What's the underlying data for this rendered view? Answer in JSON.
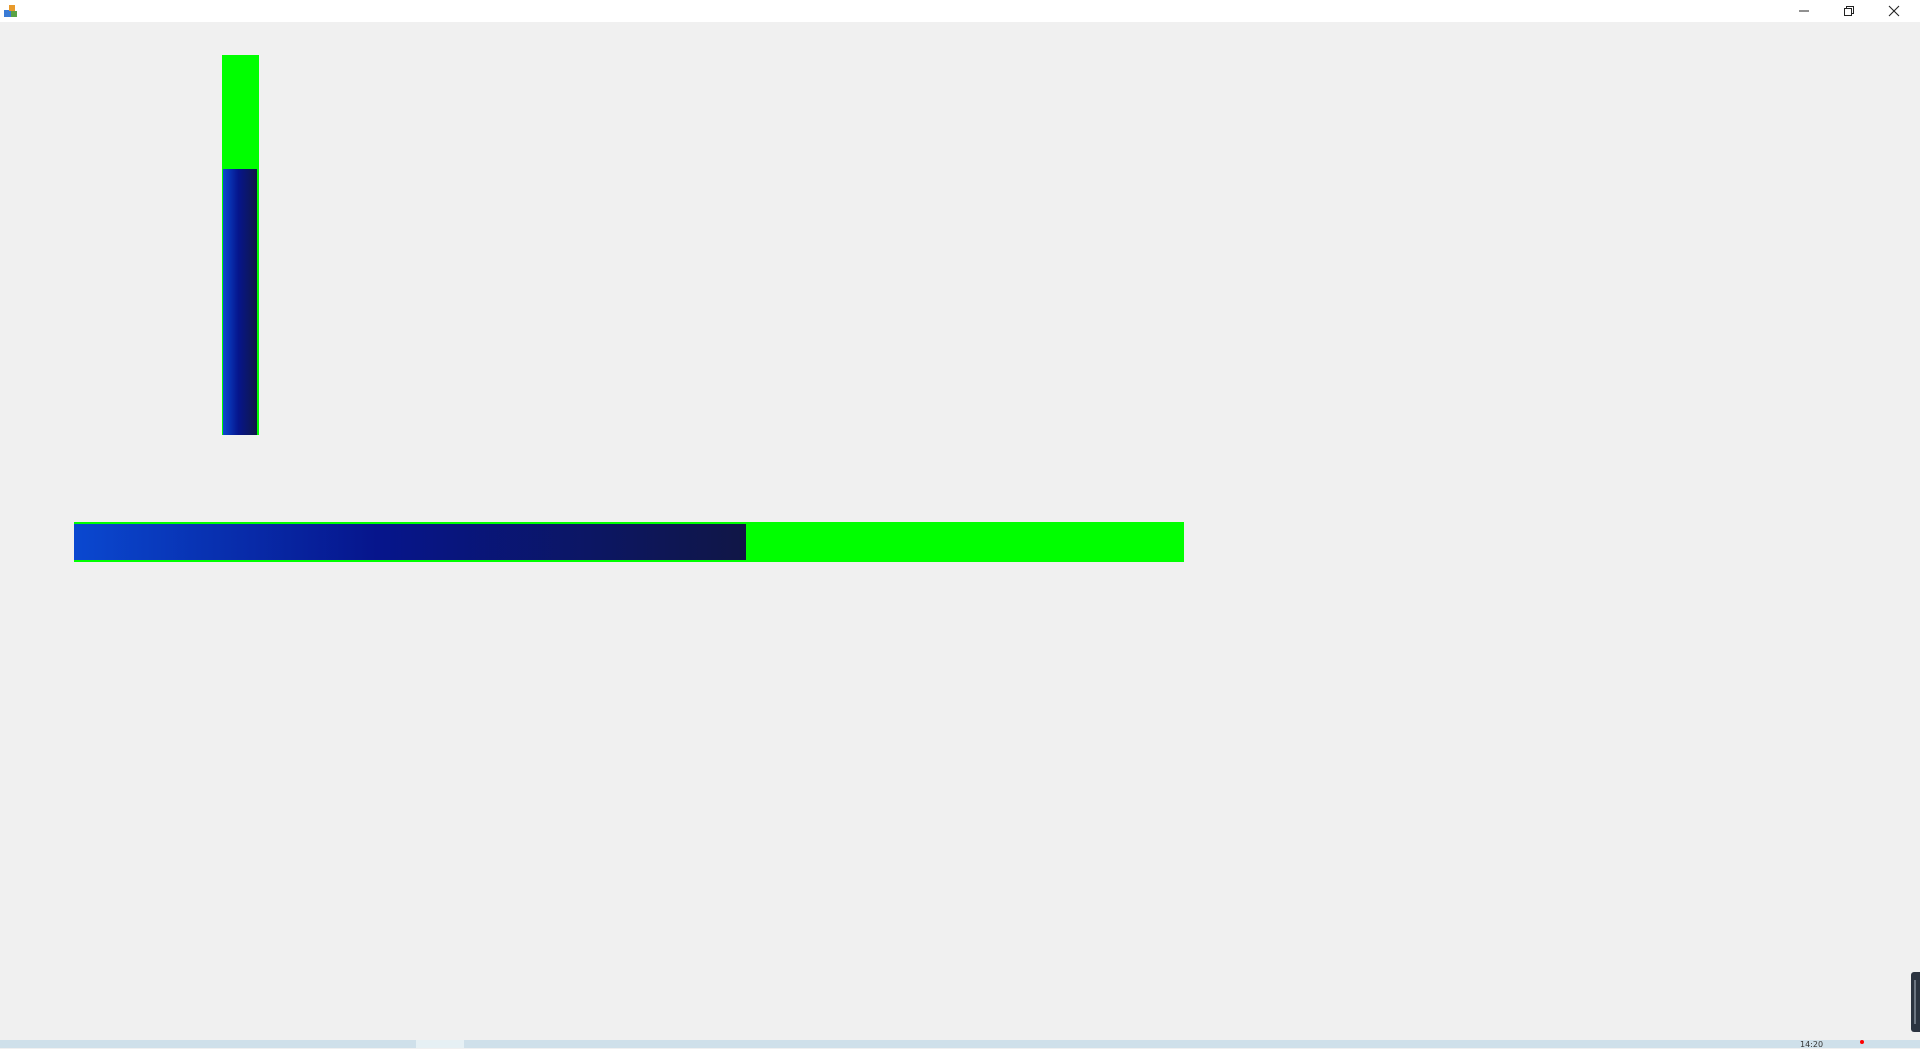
{
  "window": {
    "icon": "app-icon",
    "controls": {
      "minimize_icon": "minimize-icon",
      "restore_icon": "restore-icon",
      "close_icon": "close-icon"
    }
  },
  "progress_bars": {
    "vertical": {
      "orientation": "vertical",
      "value_fraction": 0.7,
      "track_color": "#00ff00",
      "fill_gradient": [
        "#0a48d0",
        "#06158c",
        "#101646"
      ]
    },
    "horizontal": {
      "orientation": "horizontal",
      "value_fraction": 0.605,
      "track_color": "#00ff00",
      "fill_gradient": [
        "#0a48d0",
        "#06158c",
        "#101646"
      ]
    }
  },
  "taskbar": {
    "clock_text": "14:20"
  }
}
